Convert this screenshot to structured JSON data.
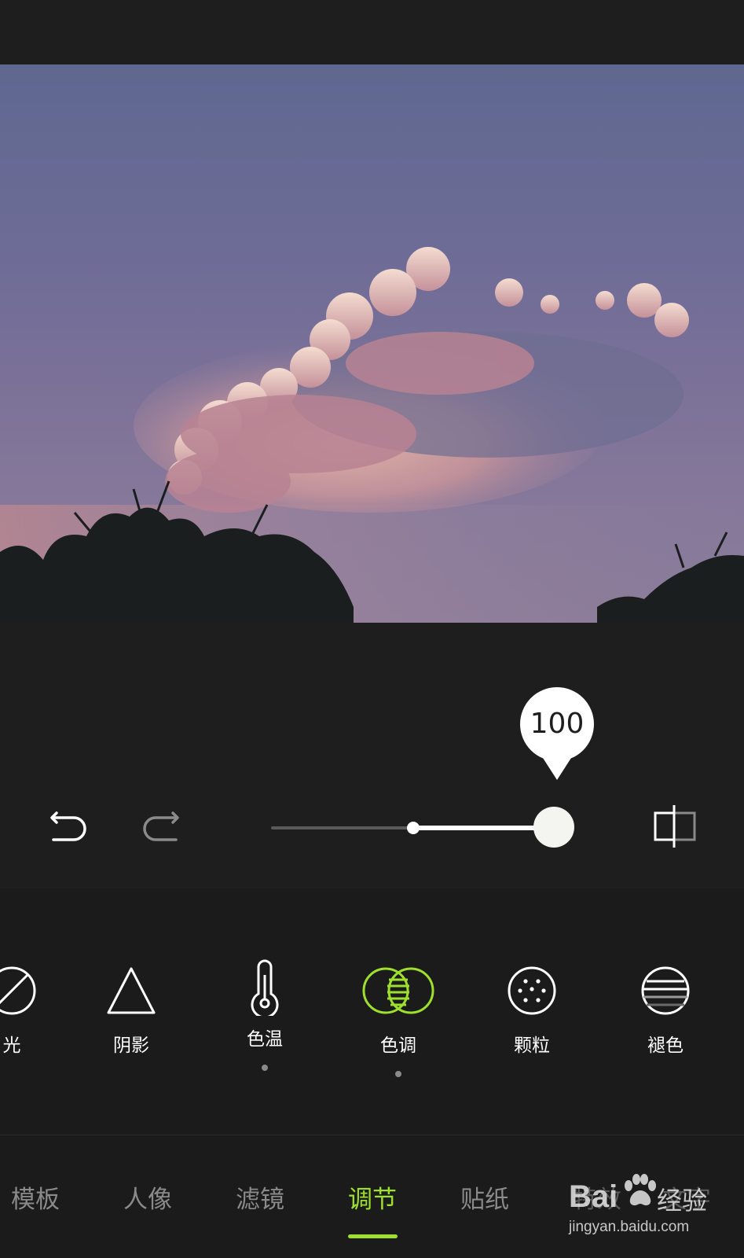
{
  "photo": {
    "description_icon": "sky-clouds-photo"
  },
  "adjust": {
    "value_label": "100",
    "slider_value": 100,
    "undo_icon": "undo-icon",
    "redo_icon": "redo-icon",
    "compare_icon": "compare-icon"
  },
  "tools": [
    {
      "id": "highlight",
      "label": "光",
      "icon": "light-icon",
      "active": false,
      "modified": false
    },
    {
      "id": "shadow",
      "label": "阴影",
      "icon": "triangle-icon",
      "active": false,
      "modified": false
    },
    {
      "id": "temperature",
      "label": "色温",
      "icon": "thermometer-icon",
      "active": false,
      "modified": true
    },
    {
      "id": "tone",
      "label": "色调",
      "icon": "overlap-circles-icon",
      "active": true,
      "modified": true
    },
    {
      "id": "grain",
      "label": "颗粒",
      "icon": "grain-dots-icon",
      "active": false,
      "modified": false
    },
    {
      "id": "fade",
      "label": "褪色",
      "icon": "fade-stripes-icon",
      "active": false,
      "modified": false
    }
  ],
  "nav": {
    "tabs": [
      "模板",
      "人像",
      "滤镜",
      "调节",
      "贴纸",
      "特效",
      "文字"
    ],
    "active_index": 3
  },
  "watermark": {
    "brand": "Bai",
    "cn": "经验",
    "url": "jingyan.baidu.com"
  },
  "colors": {
    "accent": "#9ee02c",
    "background": "#1e1e1e",
    "inactive_text": "#8a8a8a"
  }
}
